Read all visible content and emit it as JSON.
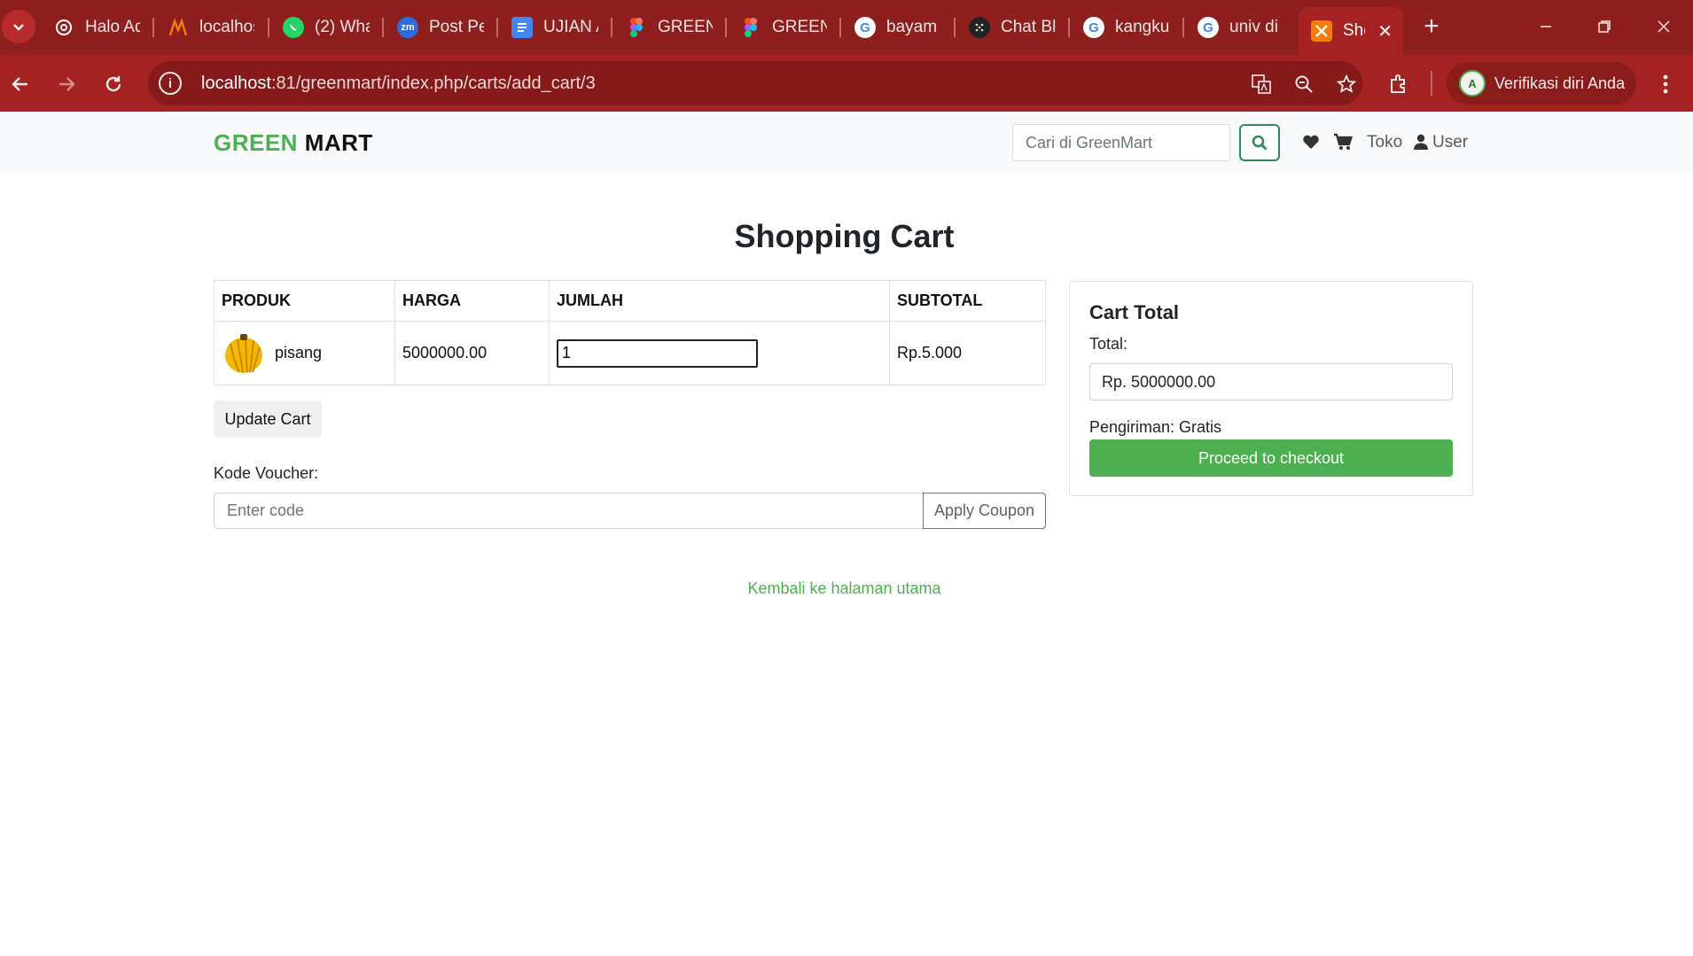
{
  "browser": {
    "tabs": [
      {
        "title": "Halo Ad",
        "icon": "openai-icon",
        "color": "#ffffff"
      },
      {
        "title": "localhos",
        "icon": "xampp-icon",
        "color": "#f57c00"
      },
      {
        "title": "(2) Wha",
        "icon": "whatsapp-icon",
        "color": "#25d366"
      },
      {
        "title": "Post Pe",
        "icon": "zoom-icon",
        "color": "#2d6cdf"
      },
      {
        "title": "UJIAN A",
        "icon": "docs-icon",
        "color": "#4285f4"
      },
      {
        "title": "GREENM",
        "icon": "figma-icon",
        "color": "#f24e1e"
      },
      {
        "title": "GREENM",
        "icon": "figma-icon",
        "color": "#f24e1e"
      },
      {
        "title": "bayam",
        "icon": "google-icon",
        "color": "#ffffff"
      },
      {
        "title": "Chat Bl",
        "icon": "chat-icon",
        "color": "#222222"
      },
      {
        "title": "kangku",
        "icon": "google-icon",
        "color": "#ffffff"
      },
      {
        "title": "univ di",
        "icon": "google-icon",
        "color": "#ffffff"
      }
    ],
    "active_tab": {
      "title": "Sho",
      "icon": "xampp-icon"
    },
    "url_host": "localhost",
    "url_rest": ":81/greenmart/index.php/carts/add_cart/3",
    "profile_label": "Verifikasi diri Anda",
    "profile_initial": "A"
  },
  "navbar": {
    "brand_green": "GREEN",
    "brand_dark": "MART",
    "search_placeholder": "Cari di GreenMart",
    "toko_label": "Toko",
    "user_label": "User"
  },
  "cart": {
    "title": "Shopping Cart",
    "headers": {
      "produk": "PRODUK",
      "harga": "HARGA",
      "jumlah": "JUMLAH",
      "subtotal": "SUBTOTAL"
    },
    "items": [
      {
        "name": "pisang",
        "price": "5000000.00",
        "qty": "1",
        "subtotal": "Rp.5.000"
      }
    ],
    "update_label": "Update Cart",
    "voucher_label": "Kode Voucher:",
    "voucher_placeholder": "Enter code",
    "apply_label": "Apply Coupon"
  },
  "total": {
    "title": "Cart Total",
    "label": "Total:",
    "value": "Rp. 5000000.00",
    "shipping": "Pengiriman: Gratis",
    "checkout_label": "Proceed to checkout"
  },
  "back_link": "Kembali ke halaman utama",
  "colors": {
    "brand_green": "#4caf50",
    "browser_red": "#a52222"
  }
}
